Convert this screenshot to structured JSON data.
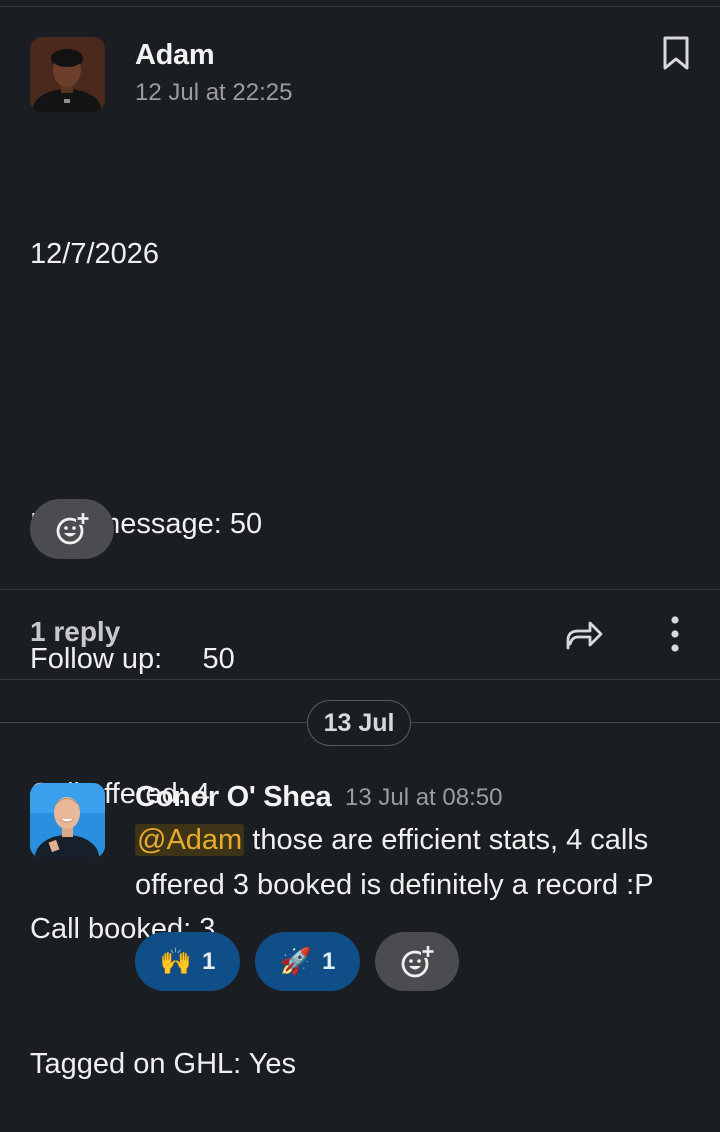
{
  "message1": {
    "author": "Adam",
    "timestamp": "12 Jul at 22:25",
    "lines": [
      "12/7/2026",
      "",
      "New message: 50",
      "Follow up:     50",
      "Call offered: 4",
      "Call booked: 3",
      "Tagged on GHL: Yes"
    ],
    "reply_count": "1 reply"
  },
  "date_separator": "13 Jul",
  "message2": {
    "author": "Conor O' Shea",
    "timestamp": "13 Jul at 08:50",
    "mention": "@Adam",
    "text": " those are efficient stats, 4 calls offered 3 booked is definitely a record :P",
    "reactions": [
      {
        "emoji": "🙌",
        "count": "1"
      },
      {
        "emoji": "🚀",
        "count": "1"
      }
    ]
  },
  "colors": {
    "background": "#1a1d21",
    "mention": "#e8ab2e",
    "reaction_bg": "#0f4e86"
  },
  "icons": [
    "bookmark-icon",
    "add-reaction-icon",
    "share-icon",
    "more-vertical-icon"
  ]
}
